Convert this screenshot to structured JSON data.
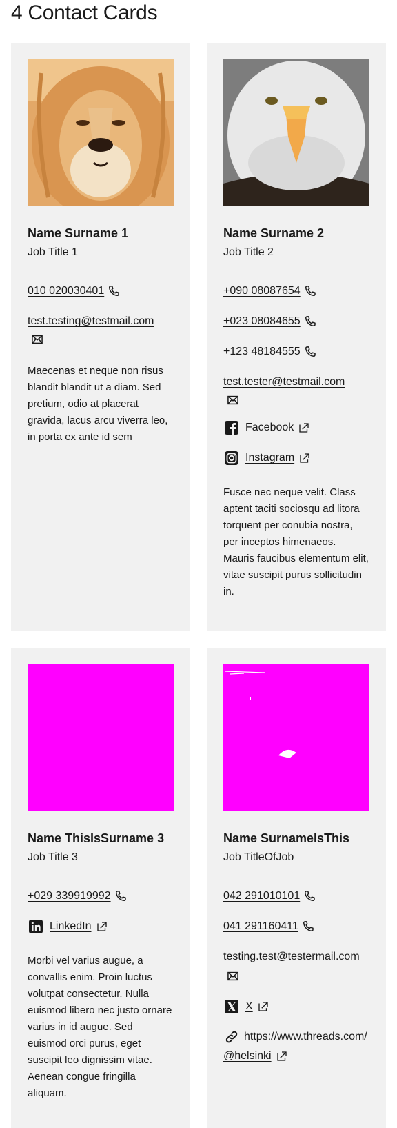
{
  "page": {
    "title": "4 Contact Cards"
  },
  "cards": [
    {
      "image": "lion-photo",
      "name": "Name Surname 1",
      "job": "Job Title 1",
      "phones": [
        "010 020030401"
      ],
      "email": "test.testing@testmail.com",
      "description": "Maecenas et neque non risus blandit blandit ut a diam. Sed pretium, odio at placerat gravida, lacus arcu viverra leo, in porta ex ante id sem"
    },
    {
      "image": "eagle-photo",
      "name": "Name Surname 2",
      "job": "Job Title 2",
      "phones": [
        "+090 08087654",
        "+023 08084655",
        "+123 48184555"
      ],
      "email": "test.tester@testmail.com",
      "socials": [
        {
          "label": "Facebook",
          "icon": "facebook-icon"
        },
        {
          "label": "Instagram",
          "icon": "instagram-icon"
        }
      ],
      "description": "Fusce nec neque velit. Class aptent taciti sociosqu ad litora torquent per conubia nostra, per inceptos himenaeos. Mauris faucibus elementum elit, vitae suscipit purus sollicitudin in."
    },
    {
      "image": "placeholder-magenta",
      "name": "Name ThisIsSurname 3",
      "job": "Job Title 3",
      "phones": [
        "+029 339919992"
      ],
      "socials": [
        {
          "label": "LinkedIn",
          "icon": "linkedin-icon"
        }
      ],
      "description": "Morbi vel varius augue, a convallis enim. Proin luctus volutpat consectetur. Nulla euismod libero nec justo ornare varius in id augue. Sed euismod orci purus, eget suscipit leo dignissim vitae. Aenean congue fringilla aliquam."
    },
    {
      "image": "placeholder-magenta",
      "name": "Name SurnameIsThis",
      "job": "Job TitleOfJob",
      "phones": [
        "042 291010101",
        "041 291160411"
      ],
      "email": "testing.test@testermail.com",
      "socials": [
        {
          "label": "X",
          "icon": "x-icon"
        },
        {
          "label": "https://www.threads.com/@helsinki",
          "icon": "link-icon"
        }
      ]
    }
  ],
  "colors": {
    "card_bg": "#f1f1f1",
    "text": "#1a1a1a",
    "placeholder": "#ff00ff"
  }
}
